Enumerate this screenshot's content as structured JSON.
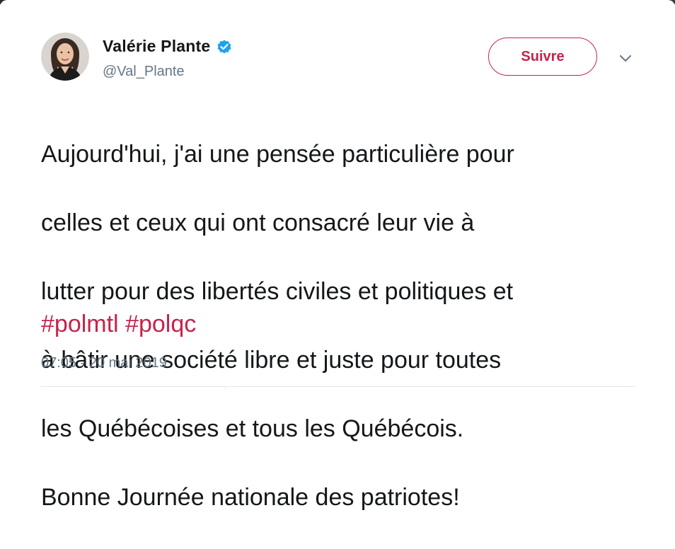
{
  "user": {
    "display_name": "Valérie Plante",
    "handle": "@Val_Plante",
    "verified": true,
    "avatar_icon": "profile-photo"
  },
  "actions": {
    "follow_label": "Suivre",
    "menu_icon": "chevron-down-icon"
  },
  "tweet": {
    "lines": [
      "Aujourd'hui, j'ai une pensée particulière pour",
      "celles et ceux qui ont consacré leur vie à",
      "lutter pour des libertés civiles et politiques et",
      "à bâtir une société libre et juste pour toutes",
      "les Québécoises et tous les Québécois.",
      "Bonne Journée nationale des patriotes!"
    ],
    "hashtags": [
      "#polmtl",
      "#polqc"
    ],
    "timestamp": "07:05 - 20 mai 2019"
  },
  "colors": {
    "accent": "#c5244b",
    "verified_blue": "#1da1f2",
    "secondary_text": "#657786",
    "primary_text": "#14171a"
  }
}
